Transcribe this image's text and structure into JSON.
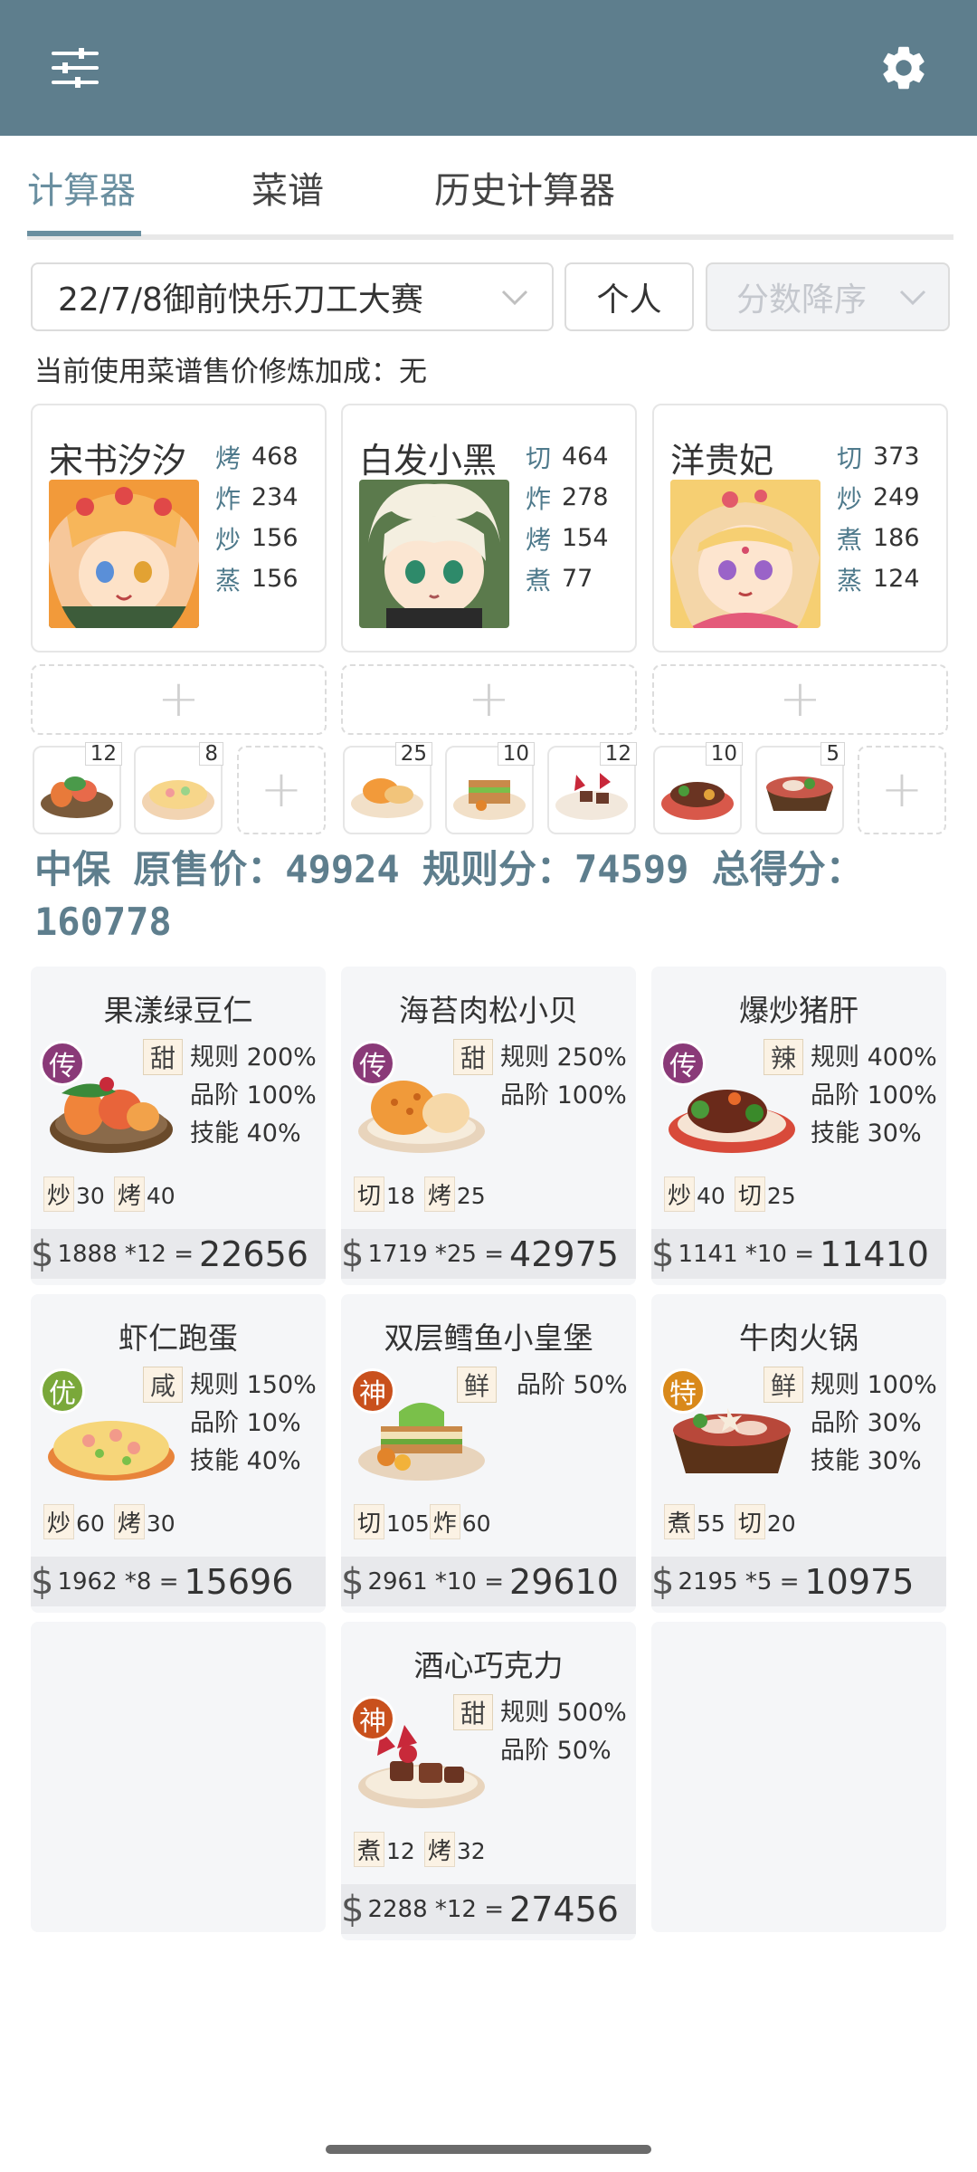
{
  "tabs": [
    {
      "label": "计算器",
      "active": true
    },
    {
      "label": "菜谱"
    },
    {
      "label": "历史计算器"
    }
  ],
  "selects": {
    "event": "22/7/8御前快乐刀工大赛",
    "mode": "个人",
    "sort": "分数降序"
  },
  "note": "当前使用菜谱售价修炼加成：无",
  "chefs": [
    {
      "name": "宋书汐汐",
      "skills": [
        {
          "k": "烤",
          "v": "468"
        },
        {
          "k": "炸",
          "v": "234"
        },
        {
          "k": "炒",
          "v": "156"
        },
        {
          "k": "蒸",
          "v": "156"
        }
      ]
    },
    {
      "name": "白发小黑",
      "skills": [
        {
          "k": "切",
          "v": "464"
        },
        {
          "k": "炸",
          "v": "278"
        },
        {
          "k": "烤",
          "v": "154"
        },
        {
          "k": "煮",
          "v": "77"
        }
      ]
    },
    {
      "name": "洋贵妃",
      "skills": [
        {
          "k": "切",
          "v": "373"
        },
        {
          "k": "炒",
          "v": "249"
        },
        {
          "k": "煮",
          "v": "186"
        },
        {
          "k": "蒸",
          "v": "124"
        }
      ]
    }
  ],
  "ingredient_counts": [
    "12",
    "8",
    "25",
    "10",
    "12",
    "10",
    "5"
  ],
  "summary": "中保 原售价：49924 规则分：74599 总得分：160778",
  "recipes": [
    {
      "title": "果漾绿豆仁",
      "tier": "传",
      "taste": "甜",
      "bonus": [
        "规则 200%",
        "品阶 100%",
        "技能 40%"
      ],
      "req": [
        {
          "k": "炒",
          "v": "30"
        },
        {
          "k": "烤",
          "v": "40"
        }
      ],
      "price": "1888",
      "mult": "*12",
      "total": "22656"
    },
    {
      "title": "海苔肉松小贝",
      "tier": "传",
      "taste": "甜",
      "bonus": [
        "规则 250%",
        "品阶 100%"
      ],
      "req": [
        {
          "k": "切",
          "v": "18"
        },
        {
          "k": "烤",
          "v": "25"
        }
      ],
      "price": "1719",
      "mult": "*25",
      "total": "42975"
    },
    {
      "title": "爆炒猪肝",
      "tier": "传",
      "taste": "辣",
      "bonus": [
        "规则 400%",
        "品阶 100%",
        "技能 30%"
      ],
      "req": [
        {
          "k": "炒",
          "v": "40"
        },
        {
          "k": "切",
          "v": "25"
        }
      ],
      "price": "1141",
      "mult": "*10",
      "total": "11410"
    },
    {
      "title": "虾仁跑蛋",
      "tier": "优",
      "taste": "咸",
      "bonus": [
        "规则 150%",
        "品阶 10%",
        "技能 40%"
      ],
      "req": [
        {
          "k": "炒",
          "v": "60"
        },
        {
          "k": "烤",
          "v": "30"
        }
      ],
      "price": "1962",
      "mult": "*8",
      "total": "15696"
    },
    {
      "title": "双层鳕鱼小皇堡",
      "tier": "神",
      "taste": "鲜",
      "bonus": [
        "品阶 50%"
      ],
      "req": [
        {
          "k": "切",
          "v": "105"
        },
        {
          "k": "炸",
          "v": "60"
        }
      ],
      "price": "2961",
      "mult": "*10",
      "total": "29610"
    },
    {
      "title": "牛肉火锅",
      "tier": "特",
      "taste": "鲜",
      "bonus": [
        "规则 100%",
        "品阶 30%",
        "技能 30%"
      ],
      "req": [
        {
          "k": "煮",
          "v": "55"
        },
        {
          "k": "切",
          "v": "20"
        }
      ],
      "price": "2195",
      "mult": "*5",
      "total": "10975"
    },
    {
      "title": "酒心巧克力",
      "tier": "神",
      "taste": "甜",
      "bonus": [
        "规则 500%",
        "品阶 50%"
      ],
      "req": [
        {
          "k": "煮",
          "v": "12"
        },
        {
          "k": "烤",
          "v": "32"
        }
      ],
      "price": "2288",
      "mult": "*12",
      "total": "27456"
    }
  ],
  "colors": {
    "header": "#5e7e8d",
    "accent": "#6a8fa0",
    "tier_legend": "#8a3a78",
    "tier_excellent": "#7aa83a",
    "tier_divine": "#c9501c",
    "tier_special": "#d9891a"
  },
  "icons": {
    "filter": "sliders-icon",
    "settings": "gear-icon",
    "dropdown": "chevron-down-icon",
    "add": "plus-icon"
  }
}
